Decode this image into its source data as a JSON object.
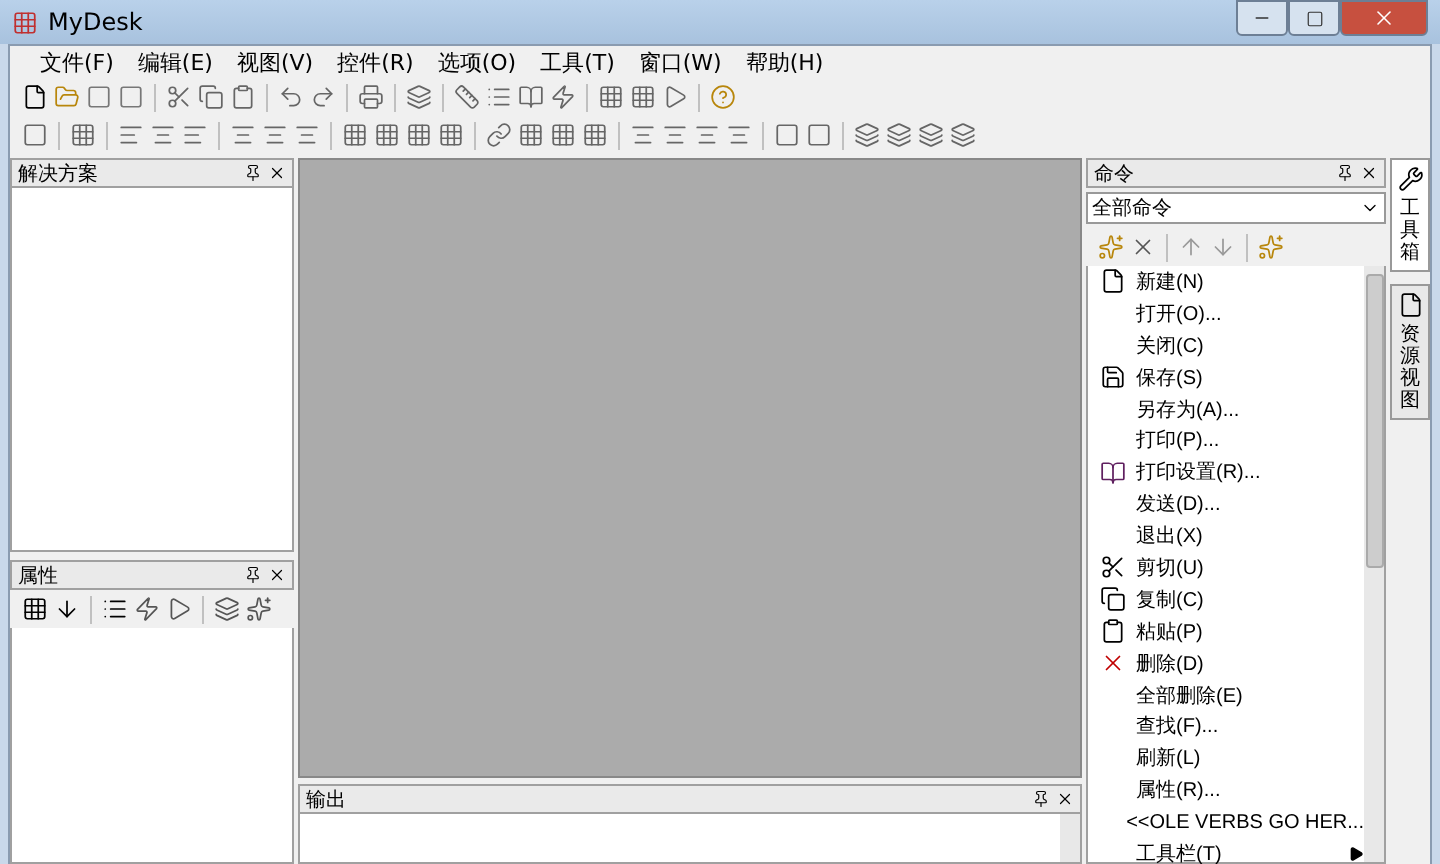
{
  "window": {
    "title": "MyDesk"
  },
  "menu": [
    "文件(F)",
    "编辑(E)",
    "视图(V)",
    "控件(R)",
    "选项(O)",
    "工具(T)",
    "窗口(W)",
    "帮助(H)"
  ],
  "solution_panel": {
    "title": "解决方案"
  },
  "properties_panel": {
    "title": "属性"
  },
  "output_panel": {
    "title": "输出"
  },
  "commands_panel": {
    "title": "命令",
    "filter": "全部命令",
    "items": [
      {
        "label": "新建(N)",
        "kind": "new"
      },
      {
        "label": "打开(O)...",
        "kind": "plain"
      },
      {
        "label": "关闭(C)",
        "kind": "plain"
      },
      {
        "label": "保存(S)",
        "kind": "save"
      },
      {
        "label": "另存为(A)...",
        "kind": "plain"
      },
      {
        "label": "打印(P)...",
        "kind": "plain"
      },
      {
        "label": "打印设置(R)...",
        "kind": "print-setup"
      },
      {
        "label": "发送(D)...",
        "kind": "plain"
      },
      {
        "label": "退出(X)",
        "kind": "plain"
      },
      {
        "label": "剪切(U)",
        "kind": "cut"
      },
      {
        "label": "复制(C)",
        "kind": "copy"
      },
      {
        "label": "粘贴(P)",
        "kind": "paste"
      },
      {
        "label": "删除(D)",
        "kind": "delete"
      },
      {
        "label": "全部删除(E)",
        "kind": "plain"
      },
      {
        "label": "查找(F)...",
        "kind": "plain"
      },
      {
        "label": "刷新(L)",
        "kind": "plain"
      },
      {
        "label": "属性(R)...",
        "kind": "plain"
      },
      {
        "label": "<<OLE VERBS GO HER...",
        "kind": "plain"
      },
      {
        "label": "工具栏(T)",
        "kind": "submenu"
      }
    ]
  },
  "side_tabs": [
    {
      "label": "工具箱",
      "selected": true
    },
    {
      "label": "资源视图",
      "selected": false
    }
  ]
}
